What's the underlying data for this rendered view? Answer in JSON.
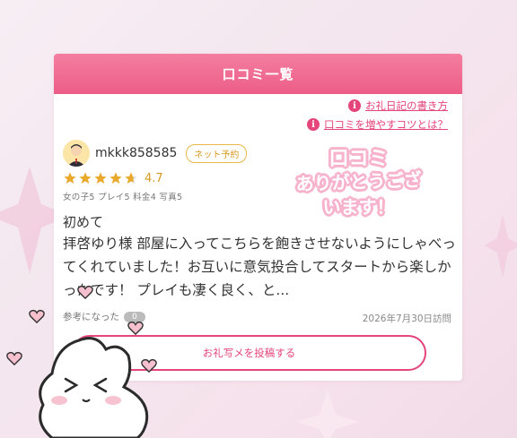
{
  "card": {
    "title": "口コミ一覧",
    "header_color": "#ec5d87",
    "accent_color": "#e4457a"
  },
  "links": [
    {
      "label": "お礼日記の書き方",
      "icon": "info-icon"
    },
    {
      "label": "口コミを増やすコツとは？",
      "icon": "info-icon"
    }
  ],
  "review": {
    "user": {
      "name": "mkkk858585",
      "avatar": "user-avatar-icon",
      "tag": "ネット予約"
    },
    "rating": {
      "value": "4.7",
      "score": 4.7,
      "max": 5
    },
    "stats": "女の子5  プレイ5  料金4  写真5",
    "stamp": {
      "line1": "口コミ",
      "line2": "ありがとうござ",
      "line3": "います！"
    },
    "title": "初めて",
    "body": "拝啓ゆり様 部屋に入ってこちらを飽きさせないようにしゃべってくれていました！お互いに意気投合してスタートから楽しかったです！ プレイも凄く良く、と...",
    "helpful_label": "参考になった",
    "helpful_count": "0",
    "date": "2026年7月30日訪問"
  },
  "post_button": {
    "label": "お礼写メを投稿する"
  },
  "decorations": [
    "heart-sticker-icon",
    "bunny-sticker-icon",
    "star-sparkle-icon"
  ]
}
